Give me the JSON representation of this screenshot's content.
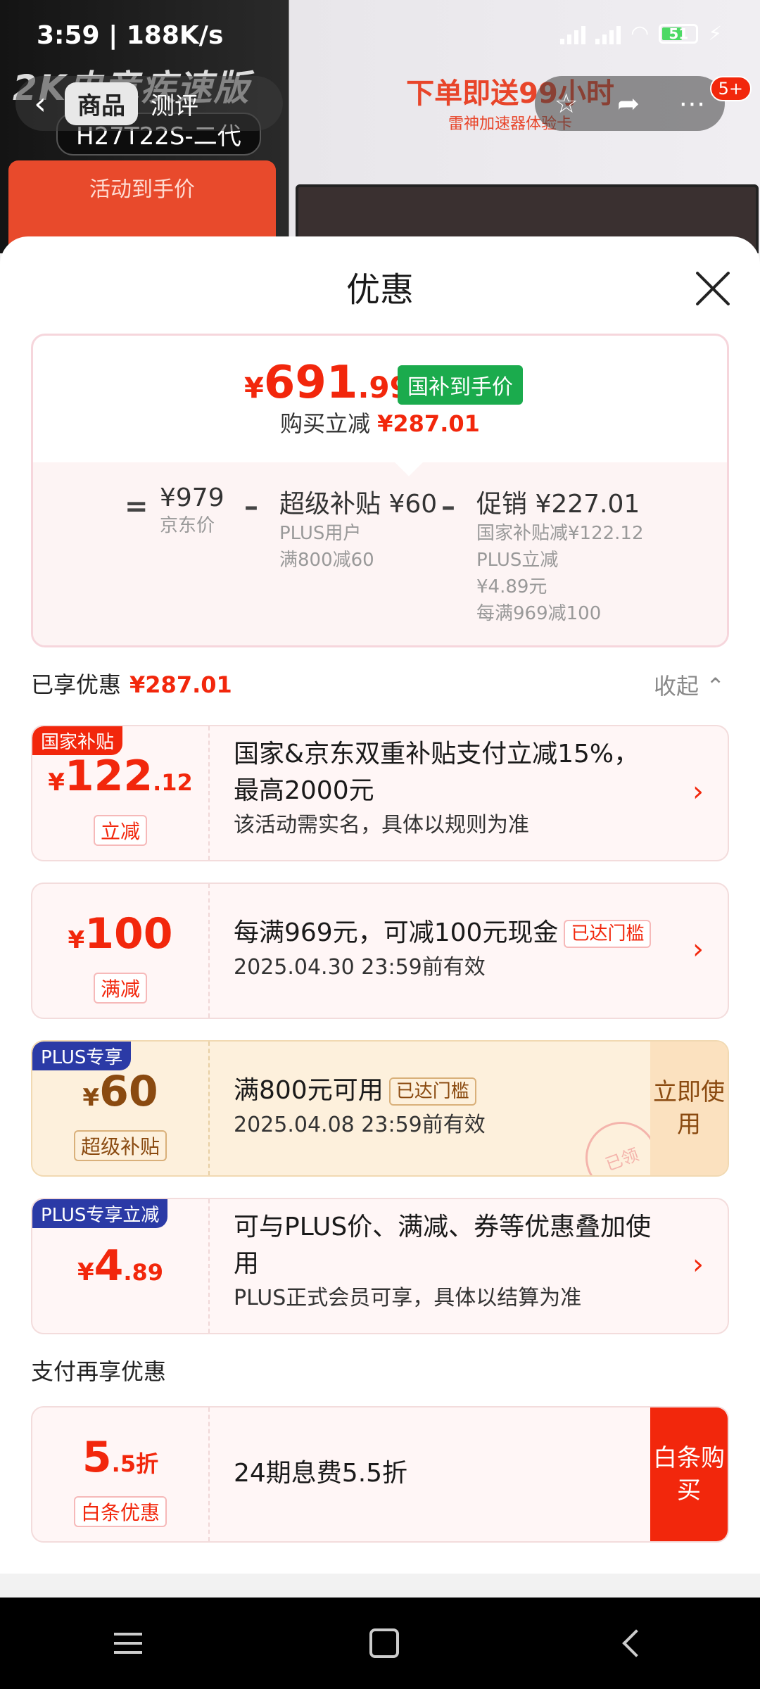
{
  "status_bar": {
    "time": "3:59 | 188K/s",
    "battery": "51"
  },
  "background": {
    "left_text": "2K电竞疾速版",
    "model": "H27T22S-二代",
    "price_label": "活动到手价",
    "banner_line1": "下单即送99小时",
    "banner_line2": "雷神加速器体验卡"
  },
  "nav": {
    "tab_goods": "商品",
    "tab_review": "测评",
    "badge": "5+"
  },
  "sheet": {
    "title": "优惠"
  },
  "summary": {
    "price_symbol": "¥",
    "price_int": "691",
    "price_dec": ".99",
    "price_badge": "国补到手价",
    "reduce_label": "购买立减",
    "reduce_value": "¥287.01",
    "jd_price": "¥979",
    "jd_price_label": "京东价",
    "super_subsidy": "超级补贴 ¥60",
    "super_sub1": "PLUS用户",
    "super_sub2": "满800减60",
    "promo": "促销 ¥227.01",
    "promo_sub1": "国家补贴减¥122.12",
    "promo_sub2": "PLUS立减",
    "promo_sub3": "¥4.89元",
    "promo_sub4": "每满969减100"
  },
  "enjoyed": {
    "label": "已享优惠",
    "value": "¥287.01",
    "collapse": "收起"
  },
  "coupons": [
    {
      "tag": "国家补贴",
      "sym": "¥",
      "int": "122",
      "dec": ".12",
      "badge": "立减",
      "title": "国家&京东双重补贴支付立减15%，最高2000元",
      "desc": "该活动需实名，具体以规则为准"
    },
    {
      "sym": "¥",
      "int": "100",
      "badge": "满减",
      "title": "每满969元，可减100元现金",
      "reached": "已达门槛",
      "desc": "2025.04.30 23:59前有效"
    },
    {
      "tag": "PLUS专享",
      "sym": "¥",
      "int": "60",
      "badge": "超级补贴",
      "title": "满800元可用",
      "reached": "已达门槛",
      "desc": "2025.04.08 23:59前有效",
      "action": "立即使用",
      "stamp": "已领"
    },
    {
      "tag": "PLUS专享立减",
      "sym": "¥",
      "int": "4",
      "dec": ".89",
      "title": "可与PLUS价、满减、券等优惠叠加使用",
      "desc": "PLUS正式会员可享，具体以结算为准"
    }
  ],
  "pay": {
    "title": "支付再享优惠",
    "int": "5",
    "dec": ".5折",
    "badge": "白条优惠",
    "text": "24期息费5.5折",
    "action": "白条购买"
  },
  "colors": {
    "accent": "#f2270c",
    "green": "#1bab4d",
    "plus_blue": "#2b3aa6",
    "gold": "#8a4a10"
  }
}
